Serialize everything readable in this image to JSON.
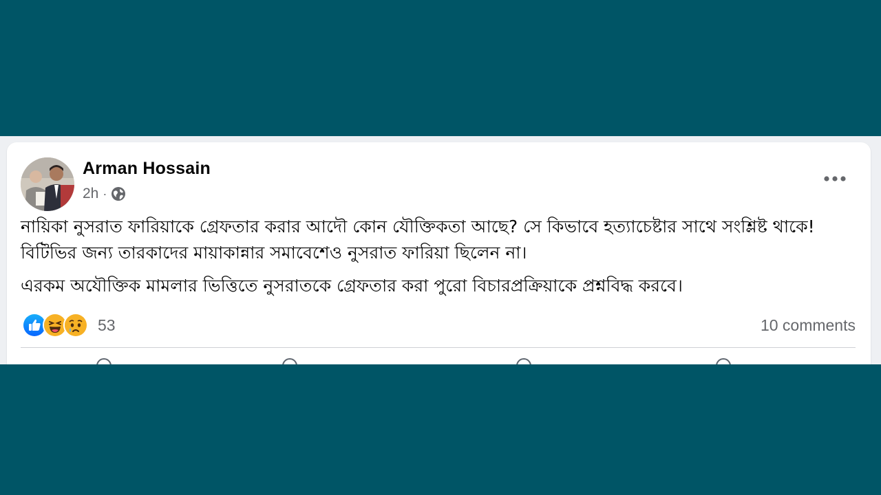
{
  "post": {
    "author": "Arman Hossain",
    "time": "2h",
    "separator": "·",
    "privacy_icon": "globe-icon",
    "menu_icon": "more-options-icon",
    "paragraphs": [
      "নায়িকা নুসরাত ফারিয়াকে গ্রেফতার করার আদৌ কোন যৌক্তিকতা আছে? সে কিভাবে হত্যাচেষ্টার সাথে সংশ্লিষ্ট থাকে! বিটিভির জন্য তারকাদের মায়াকান্নার সমাবেশেও নুসরাত ফারিয়া ছিলেন না।",
      "এরকম অযৌক্তিক মামলার ভিত্তিতে নুসরাতকে গ্রেফতার করা পুরো বিচারপ্রক্রিয়াকে প্রশ্নবিদ্ধ করবে।"
    ],
    "reactions": {
      "icons": [
        "like-icon",
        "haha-icon",
        "sad-icon"
      ],
      "count": "53"
    },
    "comments": "10 comments"
  },
  "colors": {
    "frame": "#005566",
    "like_blue": "#1877f2",
    "emoji_yellow": "#f7b125",
    "meta_gray": "#65676b"
  }
}
